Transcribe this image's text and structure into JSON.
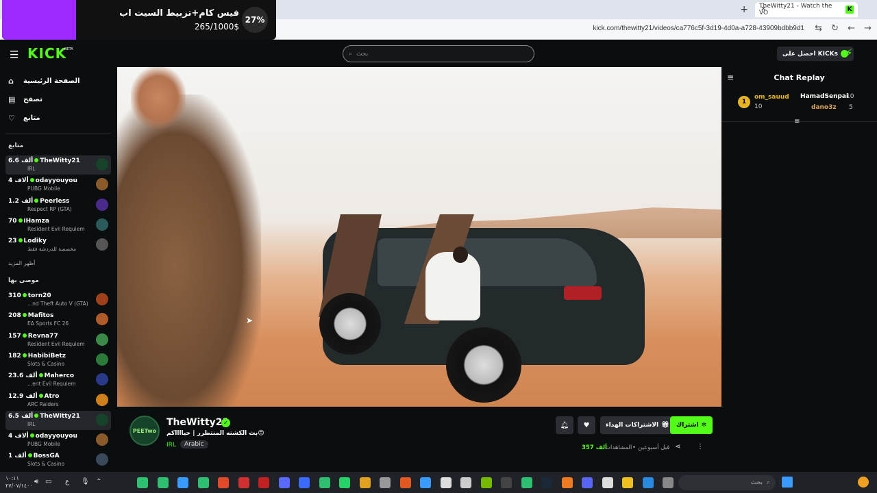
{
  "browser": {
    "tab_title": "TheWitty21 - Watch the VO",
    "url": "kick.com/thewitty21/videos/ca776c5f-3d19-4d0a-a728-43909bdbb9d1"
  },
  "donation": {
    "title": "فيس كام+تزبيط السيت اب",
    "amount": "265/1000$",
    "percent": "27%",
    "progress_fraction": 0.27
  },
  "header": {
    "logo": "KICK",
    "beta": "BETA",
    "search_placeholder": "بحث",
    "get_kicks": "احصل على KICKs"
  },
  "sidebar": {
    "nav": [
      {
        "label": "الصفحة الرئيسية",
        "icon": "home-icon"
      },
      {
        "label": "تصفح",
        "icon": "browse-icon"
      },
      {
        "label": "متابع",
        "icon": "heart-icon"
      }
    ],
    "following_title": "متابع",
    "following": [
      {
        "name": "TheWitty21",
        "viewers": "6.6 ألف",
        "category": "IRL",
        "avatar_color": "#17422a"
      },
      {
        "name": "odayyouyou",
        "viewers": "4 ألاف",
        "category": "PUBG Mobile",
        "avatar_color": "#8a5a2a"
      },
      {
        "name": "Peerless",
        "viewers": "1.2 ألف",
        "category": "Respect RP (GTA)",
        "avatar_color": "#4a2a8a"
      },
      {
        "name": "iHamza",
        "viewers": "70",
        "category": "Resident Evil Requiem",
        "avatar_color": "#2a5a5a"
      },
      {
        "name": "Lodiky",
        "viewers": "23",
        "category": "مخصصة للدردشة فقط",
        "avatar_color": "#555555"
      }
    ],
    "show_more": "أظهر المزيد",
    "recommended_title": "موصى بها",
    "recommended": [
      {
        "name": "torn20",
        "viewers": "310",
        "category": "...nd Theft Auto V (GTA)",
        "avatar_color": "#a0401a"
      },
      {
        "name": "Mafitos",
        "viewers": "208",
        "category": "EA Sports FC 26",
        "avatar_color": "#b05a2a"
      },
      {
        "name": "Revna77",
        "viewers": "157",
        "category": "Resident Evil Requiem",
        "avatar_color": "#3a8a4a"
      },
      {
        "name": "HabibiBetz",
        "viewers": "182",
        "category": "Slots & Casino",
        "avatar_color": "#2a7a3a"
      },
      {
        "name": "Maherco",
        "viewers": "23.6 ألف",
        "category": "...ent Evil Requiem",
        "avatar_color": "#2a3a8a"
      },
      {
        "name": "Atro",
        "viewers": "12.9 ألف",
        "category": "ARC Raiders",
        "avatar_color": "#d0801a"
      },
      {
        "name": "TheWitty21",
        "viewers": "6.5 ألف",
        "category": "IRL",
        "avatar_color": "#17422a"
      },
      {
        "name": "odayyouyou",
        "viewers": "4 ألاف",
        "category": "PUBG Mobile",
        "avatar_color": "#8a5a2a"
      },
      {
        "name": "BossGA",
        "viewers": "1 ألف",
        "category": "Slots & Casino",
        "avatar_color": "#3a4a5a"
      }
    ]
  },
  "channel": {
    "name": "TheWitty21",
    "avatar_text": "PEETwo",
    "title": "بث الكشته المنتظرر | حيااااكم😍",
    "category": "IRL",
    "tag": "Arabic",
    "subscribe": "اشتراك",
    "gift_subs": "الاشتراكات الهداء",
    "views_label": "المشاهدات",
    "views": "357 ألف",
    "time_ago": "قبل أسبوعين",
    "below_title": "TheWitty21 ..."
  },
  "chat": {
    "title": "Chat Replay",
    "leaderboard": [
      {
        "rank": "1",
        "name": "om_sauud",
        "value": "10"
      },
      {
        "name": "HamadSenpai",
        "value": "10"
      },
      {
        "name": "dano3z",
        "value": "5"
      }
    ]
  },
  "taskbar": {
    "search_placeholder": "بحث",
    "time": "١٠:١١",
    "date": "٢٧/٠٧/١٤٠٠",
    "lang": "ع"
  },
  "colors": {
    "accent": "#53fc18",
    "donation_purple": "#9d29ff"
  }
}
